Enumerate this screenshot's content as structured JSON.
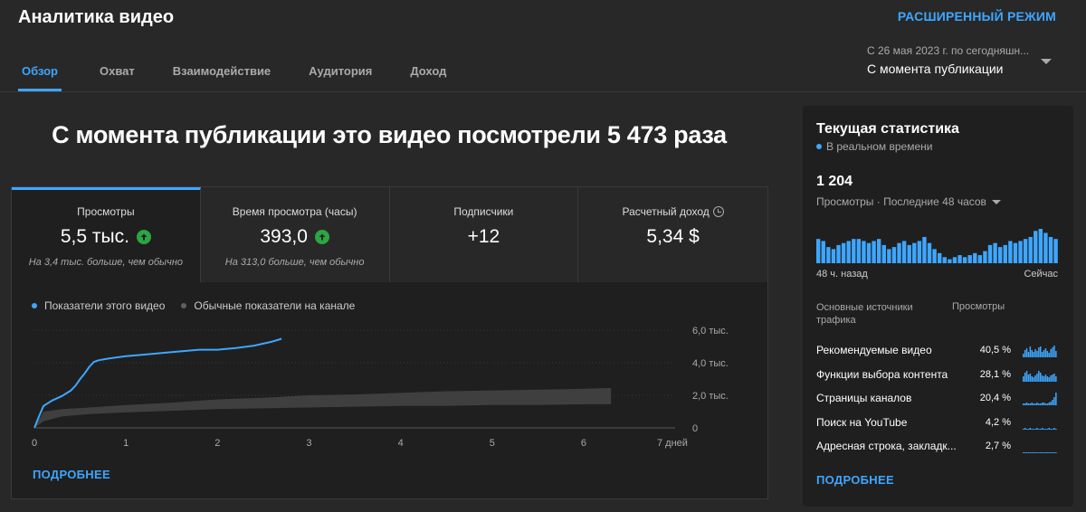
{
  "header": {
    "title": "Аналитика видео",
    "advanced_mode": "РАСШИРЕННЫЙ РЕЖИМ"
  },
  "tabs": [
    {
      "label": "Обзор",
      "active": true
    },
    {
      "label": "Охват",
      "active": false
    },
    {
      "label": "Взаимодействие",
      "active": false
    },
    {
      "label": "Аудитория",
      "active": false
    },
    {
      "label": "Доход",
      "active": false
    }
  ],
  "period": {
    "sub": "С 26 мая 2023 г. по сегодняшн...",
    "main": "С момента публикации"
  },
  "headline": "С момента публикации это видео посмотрели 5 473 раза",
  "metrics": [
    {
      "label": "Просмотры",
      "value": "5,5 тыс.",
      "note": "На 3,4 тыс. больше, чем обычно"
    },
    {
      "label": "Время просмотра (часы)",
      "value": "393,0",
      "note": "На 313,0 больше, чем обычно"
    },
    {
      "label": "Подписчики",
      "value": "+12",
      "note": ""
    },
    {
      "label": "Расчетный доход",
      "value": "5,34 $",
      "note": ""
    }
  ],
  "legend": {
    "this_video": "Показатели этого видео",
    "typical": "Обычные показатели на канале"
  },
  "chart_data": {
    "type": "line",
    "x_unit_label": "7 дней",
    "x_ticks": [
      "0",
      "1",
      "2",
      "3",
      "4",
      "5",
      "6",
      "7 дней"
    ],
    "y_ticks": [
      "0",
      "2,0 тыс.",
      "4,0 тыс.",
      "6,0 тыс."
    ],
    "ylim": [
      0,
      6000
    ],
    "xlim": [
      0,
      7
    ],
    "series": [
      {
        "name": "Показатели этого видео",
        "color": "#3ea6ff",
        "x": [
          0,
          0.05,
          0.1,
          0.2,
          0.3,
          0.4,
          0.45,
          0.5,
          0.55,
          0.6,
          0.65,
          0.7,
          0.8,
          1.0,
          1.2,
          1.5,
          1.8,
          2.0,
          2.2,
          2.4,
          2.6,
          2.7
        ],
        "y": [
          0,
          700,
          1350,
          1700,
          1950,
          2300,
          2600,
          3000,
          3350,
          3750,
          4050,
          4150,
          4250,
          4400,
          4500,
          4650,
          4800,
          4800,
          4900,
          5050,
          5300,
          5473
        ]
      }
    ],
    "typical_range": {
      "name": "Обычные показатели на канале",
      "color": "#3f3f3f",
      "x": [
        0,
        0.1,
        0.3,
        0.6,
        1,
        1.5,
        2,
        2.5,
        3,
        3.5,
        4,
        4.5,
        5,
        5.5,
        6,
        6.3
      ],
      "low": [
        0,
        400,
        700,
        850,
        950,
        1050,
        1150,
        1200,
        1250,
        1300,
        1350,
        1350,
        1400,
        1400,
        1450,
        1450
      ],
      "high": [
        0,
        1000,
        1150,
        1250,
        1400,
        1550,
        1750,
        1850,
        2000,
        2050,
        2150,
        2250,
        2300,
        2350,
        2400,
        2450
      ]
    }
  },
  "main_more": "ПОДРОБНЕЕ",
  "realtime": {
    "title": "Текущая статистика",
    "live_label": "В реальном времени",
    "count": "1 204",
    "sub": "Просмотры · Последние 48 часов",
    "axis_left": "48 ч. назад",
    "axis_right": "Сейчас",
    "bars": [
      24,
      22,
      16,
      14,
      18,
      20,
      22,
      24,
      24,
      22,
      20,
      22,
      24,
      18,
      14,
      16,
      20,
      22,
      18,
      20,
      22,
      26,
      20,
      14,
      10,
      6,
      4,
      6,
      8,
      6,
      8,
      10,
      8,
      12,
      18,
      20,
      16,
      18,
      22,
      20,
      22,
      24,
      26,
      32,
      34,
      30,
      26,
      24
    ],
    "color": "#3ea6ff"
  },
  "sources": {
    "header_left": "Основные источники трафика",
    "header_right": "Просмотры",
    "rows": [
      {
        "name": "Рекомендуемые видео",
        "pct": "40,5 %",
        "spark": [
          4,
          8,
          10,
          6,
          12,
          8,
          6,
          9,
          7,
          11,
          12,
          6,
          8,
          10,
          7,
          5,
          9,
          11,
          13,
          7
        ]
      },
      {
        "name": "Функции выбора контента",
        "pct": "28,1 %",
        "spark": [
          6,
          10,
          12,
          8,
          9,
          6,
          5,
          7,
          9,
          12,
          10,
          7,
          6,
          8,
          6,
          5,
          7,
          8,
          9,
          6
        ]
      },
      {
        "name": "Страницы каналов",
        "pct": "20,4 %",
        "spark": [
          2,
          2,
          3,
          2,
          2,
          3,
          2,
          2,
          3,
          2,
          2,
          3,
          3,
          2,
          2,
          3,
          4,
          6,
          9,
          14
        ]
      },
      {
        "name": "Поиск на YouTube",
        "pct": "4,2 %",
        "spark": [
          1,
          2,
          1,
          1,
          2,
          1,
          1,
          1,
          2,
          1,
          1,
          2,
          1,
          1,
          1,
          2,
          1,
          1,
          2,
          1
        ]
      },
      {
        "name": "Адресная строка, закладк...",
        "pct": "2,7 %",
        "spark": [
          1,
          1,
          1,
          0,
          1,
          1,
          0,
          1,
          1,
          1,
          0,
          1,
          1,
          1,
          1,
          0,
          1,
          1,
          1,
          1
        ]
      }
    ]
  },
  "side_more": "ПОДРОБНЕЕ"
}
